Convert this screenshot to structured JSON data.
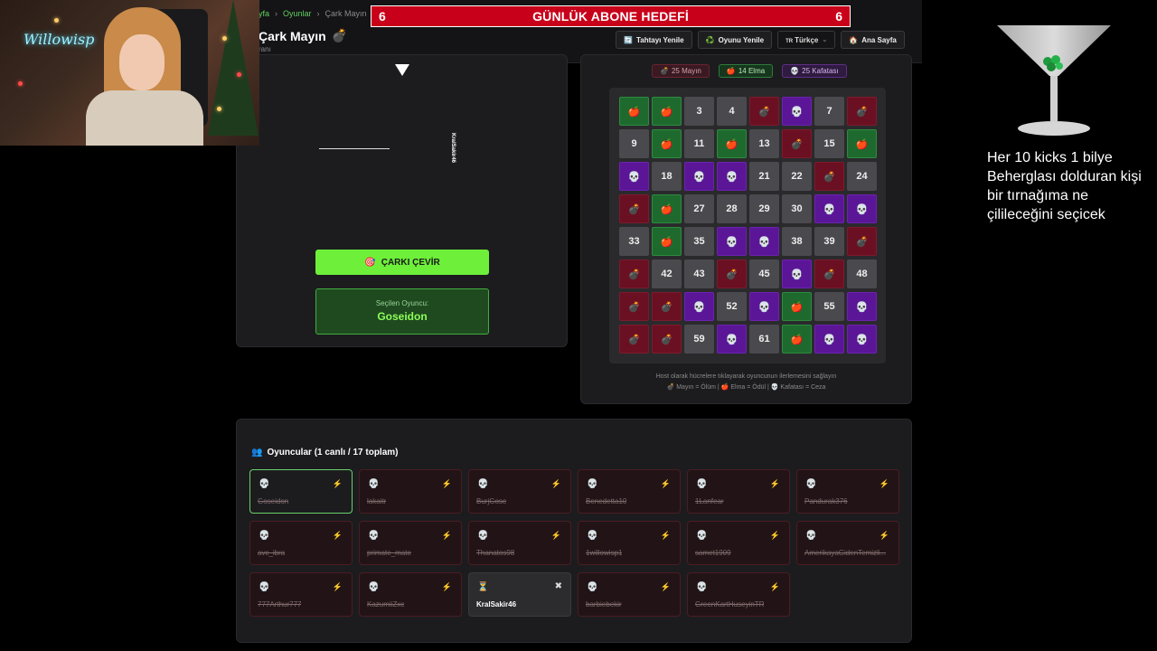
{
  "breadcrumbs": [
    "yfa",
    "Oyunlar",
    "Çark Mayın"
  ],
  "page_title": "Çark Mayın",
  "title_icon": "💣",
  "page_subtitle": "ranı",
  "goal_bar": {
    "left_count": "6",
    "title": "GÜNLÜK ABONE HEDEFİ",
    "right_count": "6",
    "color": "#c8001a"
  },
  "nav": {
    "refresh_board": {
      "icon": "🔄",
      "label": "Tahtayı Yenile"
    },
    "refresh_game": {
      "icon": "♻️",
      "label": "Oyunu Yenile"
    },
    "language": {
      "flag": "TR",
      "label": "Türkçe"
    },
    "home": {
      "icon": "🏠",
      "label": "Ana Sayfa"
    }
  },
  "wheel": {
    "player_on_wheel": "KralSakir46"
  },
  "spin_button": {
    "icon": "🎯",
    "label": "ÇARKI ÇEVİR"
  },
  "selected_player": {
    "label": "Seçilen Oyuncu:",
    "name": "Goseidon"
  },
  "counters": {
    "mines": {
      "icon": "💣",
      "label": "25 Mayın"
    },
    "apples": {
      "icon": "🍎",
      "label": "14 Elma"
    },
    "skulls": {
      "icon": "💀",
      "label": "25 Kafatası"
    }
  },
  "board": [
    "A",
    "A",
    "3",
    "4",
    "M",
    "S",
    "7",
    "M",
    "9",
    "A",
    "11",
    "A",
    "13",
    "M",
    "15",
    "A",
    "S",
    "18",
    "S",
    "S",
    "21",
    "22",
    "M",
    "24",
    "M",
    "A",
    "27",
    "28",
    "29",
    "30",
    "S",
    "S",
    "33",
    "A",
    "35",
    "S",
    "S",
    "38",
    "39",
    "M",
    "M",
    "42",
    "43",
    "M",
    "45",
    "S",
    "M",
    "48",
    "M",
    "M",
    "S",
    "52",
    "S",
    "A",
    "55",
    "S",
    "M",
    "M",
    "59",
    "S",
    "61",
    "A",
    "S",
    "S"
  ],
  "board_icons": {
    "A": "🍎",
    "M": "💣",
    "S": "💀"
  },
  "hint": {
    "line1": "Host olarak hücrelere tıklayarak oyuncunun ilerlemesini sağlayın",
    "line2": "💣 Mayın = Ölüm | 🍎 Elma = Ödül | 💀 Kafatası = Ceza"
  },
  "players_header": {
    "icon": "👥",
    "label": "Oyuncular (1 canlı / 17 toplam)"
  },
  "players": [
    {
      "name": "Goseidon",
      "status": "💀",
      "badge": "⚡",
      "state": "selected"
    },
    {
      "name": "lakaitr",
      "status": "💀",
      "badge": "⚡",
      "state": "dead"
    },
    {
      "name": "BurjGose",
      "status": "💀",
      "badge": "⚡",
      "state": "dead"
    },
    {
      "name": "Benedetta10",
      "status": "💀",
      "badge": "⚡",
      "state": "dead"
    },
    {
      "name": "1Lanfear",
      "status": "💀",
      "badge": "⚡",
      "state": "dead"
    },
    {
      "name": "Pandurak376",
      "status": "💀",
      "badge": "⚡",
      "state": "dead"
    },
    {
      "name": "avc_ibra",
      "status": "💀",
      "badge": "⚡",
      "state": "dead"
    },
    {
      "name": "primate_mate",
      "status": "💀",
      "badge": "⚡",
      "state": "dead"
    },
    {
      "name": "Thanatos98",
      "status": "💀",
      "badge": "⚡",
      "state": "dead"
    },
    {
      "name": "1willowisp1",
      "status": "💀",
      "badge": "⚡",
      "state": "dead"
    },
    {
      "name": "samet1909",
      "status": "💀",
      "badge": "⚡",
      "state": "dead"
    },
    {
      "name": "AmerikayaGidenTemizli...",
      "status": "💀",
      "badge": "⚡",
      "state": "dead"
    },
    {
      "name": "777Arthur777",
      "status": "💀",
      "badge": "⚡",
      "state": "dead"
    },
    {
      "name": "KazumiiZxc",
      "status": "💀",
      "badge": "⚡",
      "state": "dead"
    },
    {
      "name": "KralSakir46",
      "status": "⏳",
      "badge": "✖",
      "state": "alive"
    },
    {
      "name": "barbiebekir",
      "status": "💀",
      "badge": "⚡",
      "state": "dead"
    },
    {
      "name": "GreenKartHuseyinTR",
      "status": "💀",
      "badge": "⚡",
      "state": "dead"
    }
  ],
  "webcam": {
    "neon_sign": "Willowisp"
  },
  "side_text": "Her 10 kicks 1 bilye Beherglası dolduran kişi bir tırnağıma ne çilileceğini seçicek"
}
